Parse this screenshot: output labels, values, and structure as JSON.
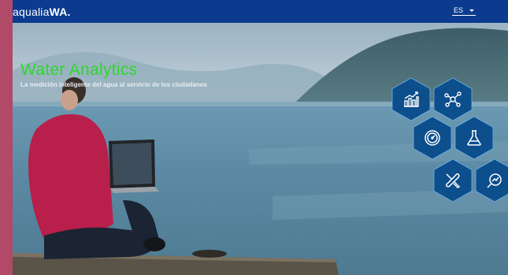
{
  "header": {
    "logo_text": "aqualia",
    "logo_bold": "WA.",
    "language": "ES"
  },
  "hero": {
    "title": "Water Analytics",
    "subtitle": "La medición inteligente del agua al servicio de los ciudadanos"
  },
  "tiles": [
    {
      "name": "bar-chart-icon"
    },
    {
      "name": "network-nodes-icon"
    },
    {
      "name": "gauge-icon"
    },
    {
      "name": "flask-icon"
    },
    {
      "name": "tools-icon"
    },
    {
      "name": "magnifier-chart-icon"
    }
  ],
  "colors": {
    "topbar": "#0b3a8f",
    "title": "#2bd82b",
    "hexagon": "#0d4e8c",
    "side_border": "#b04a68"
  }
}
